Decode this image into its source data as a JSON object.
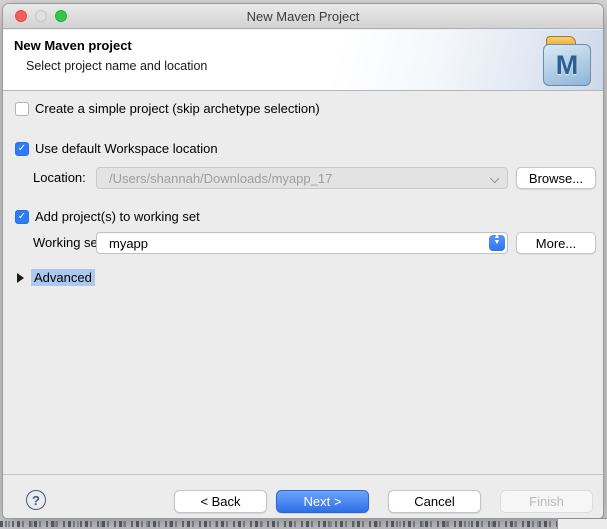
{
  "window": {
    "title": "New Maven Project"
  },
  "header": {
    "title": "New Maven project",
    "subtitle": "Select project name and location",
    "icon_letter": "M"
  },
  "form": {
    "simple_project": {
      "label": "Create a simple project (skip archetype selection)",
      "checked": false
    },
    "default_location": {
      "label": "Use default Workspace location",
      "checked": true
    },
    "location": {
      "label": "Location:",
      "value": "/Users/shannah/Downloads/myapp_17",
      "disabled": true,
      "browse_label": "Browse..."
    },
    "working_set_toggle": {
      "label": "Add project(s) to working set",
      "checked": true
    },
    "working_set": {
      "label": "Working set:",
      "value": "myapp",
      "more_label": "More..."
    },
    "advanced": {
      "label": "Advanced",
      "expanded": false
    }
  },
  "footer": {
    "help_label": "?",
    "back_label": "< Back",
    "next_label": "Next >",
    "cancel_label": "Cancel",
    "finish_label": "Finish"
  },
  "colors": {
    "accent_blue": "#2e7bf6",
    "primary_button_blue": "#2f6fe6",
    "advanced_highlight": "#abc9ef",
    "disabled_text": "#9d9d9d",
    "traffic_red": "#f2605a",
    "traffic_green": "#33c748"
  }
}
